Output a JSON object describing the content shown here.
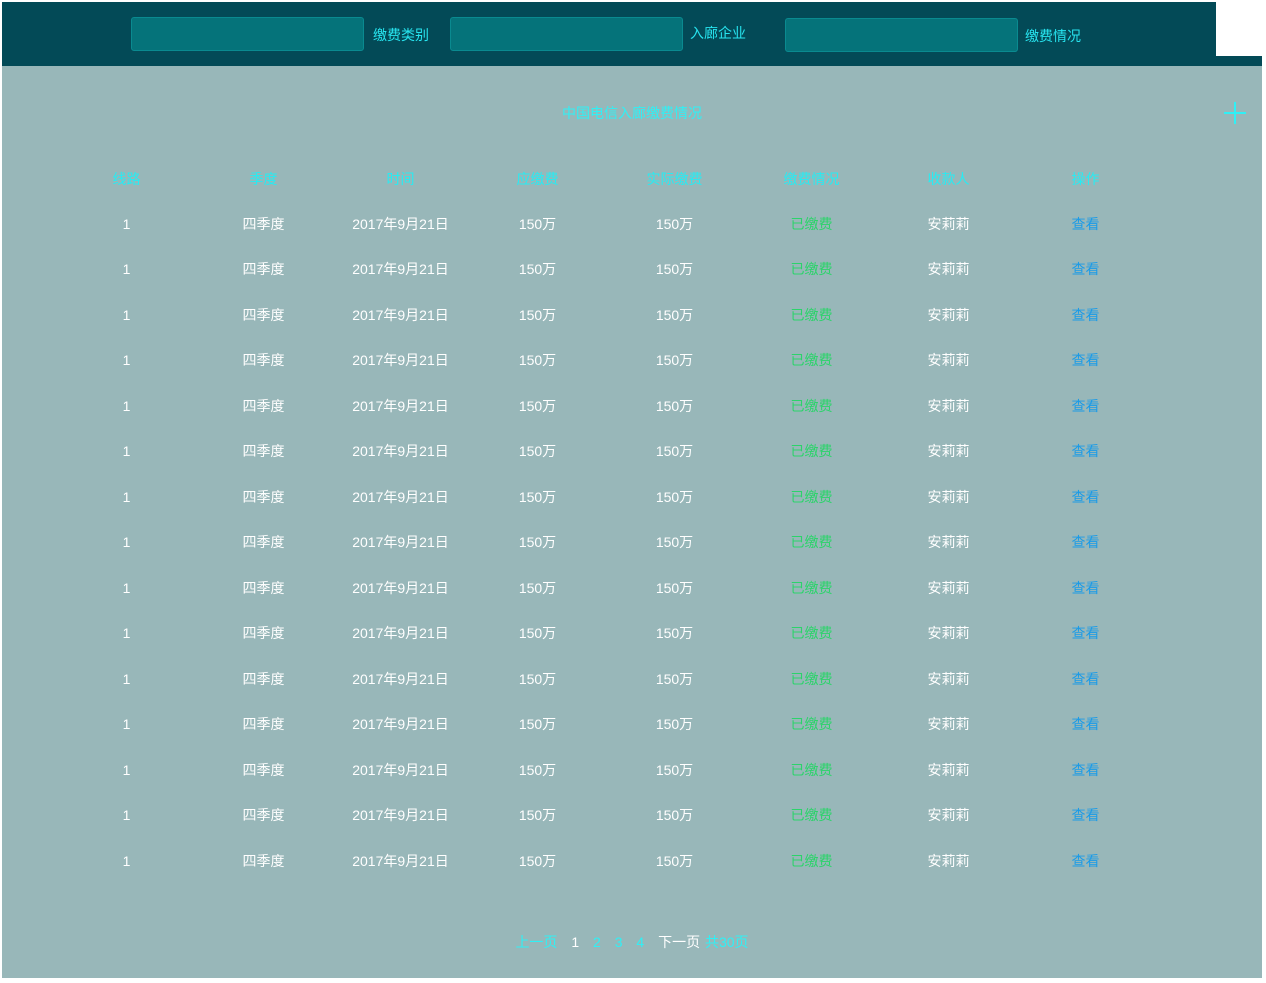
{
  "filters": [
    {
      "label": "缴费类别",
      "value": ""
    },
    {
      "label": "入廊企业",
      "value": ""
    },
    {
      "label": "缴费情况",
      "value": ""
    }
  ],
  "panel": {
    "title": "中国电信入廊缴费情况"
  },
  "table": {
    "headers": [
      "线路",
      "季度",
      "时间",
      "应缴费",
      "实际缴费",
      "缴费情况",
      "收款人",
      "操作"
    ],
    "rows": [
      [
        "1",
        "四季度",
        "2017年9月21日",
        "150万",
        "150万",
        "已缴费",
        "安莉莉",
        "查看"
      ],
      [
        "1",
        "四季度",
        "2017年9月21日",
        "150万",
        "150万",
        "已缴费",
        "安莉莉",
        "查看"
      ],
      [
        "1",
        "四季度",
        "2017年9月21日",
        "150万",
        "150万",
        "已缴费",
        "安莉莉",
        "查看"
      ],
      [
        "1",
        "四季度",
        "2017年9月21日",
        "150万",
        "150万",
        "已缴费",
        "安莉莉",
        "查看"
      ],
      [
        "1",
        "四季度",
        "2017年9月21日",
        "150万",
        "150万",
        "已缴费",
        "安莉莉",
        "查看"
      ],
      [
        "1",
        "四季度",
        "2017年9月21日",
        "150万",
        "150万",
        "已缴费",
        "安莉莉",
        "查看"
      ],
      [
        "1",
        "四季度",
        "2017年9月21日",
        "150万",
        "150万",
        "已缴费",
        "安莉莉",
        "查看"
      ],
      [
        "1",
        "四季度",
        "2017年9月21日",
        "150万",
        "150万",
        "已缴费",
        "安莉莉",
        "查看"
      ],
      [
        "1",
        "四季度",
        "2017年9月21日",
        "150万",
        "150万",
        "已缴费",
        "安莉莉",
        "查看"
      ],
      [
        "1",
        "四季度",
        "2017年9月21日",
        "150万",
        "150万",
        "已缴费",
        "安莉莉",
        "查看"
      ],
      [
        "1",
        "四季度",
        "2017年9月21日",
        "150万",
        "150万",
        "已缴费",
        "安莉莉",
        "查看"
      ],
      [
        "1",
        "四季度",
        "2017年9月21日",
        "150万",
        "150万",
        "已缴费",
        "安莉莉",
        "查看"
      ],
      [
        "1",
        "四季度",
        "2017年9月21日",
        "150万",
        "150万",
        "已缴费",
        "安莉莉",
        "查看"
      ],
      [
        "1",
        "四季度",
        "2017年9月21日",
        "150万",
        "150万",
        "已缴费",
        "安莉莉",
        "查看"
      ],
      [
        "1",
        "四季度",
        "2017年9月21日",
        "150万",
        "150万",
        "已缴费",
        "安莉莉",
        "查看"
      ]
    ]
  },
  "pagination": {
    "prev": "上一页",
    "pages": [
      "1",
      "2",
      "3",
      "4"
    ],
    "current": "1",
    "next": "下一页",
    "total": "共30页"
  },
  "colors": {
    "header_bg": "#034a57",
    "input_bg": "#05737a",
    "panel_bg": "#98b7b9",
    "accent_cyan": "#2ff0f5",
    "status_green": "#2bd46a",
    "link_blue": "#1a9be8"
  },
  "icons": {
    "add": "plus-icon"
  }
}
